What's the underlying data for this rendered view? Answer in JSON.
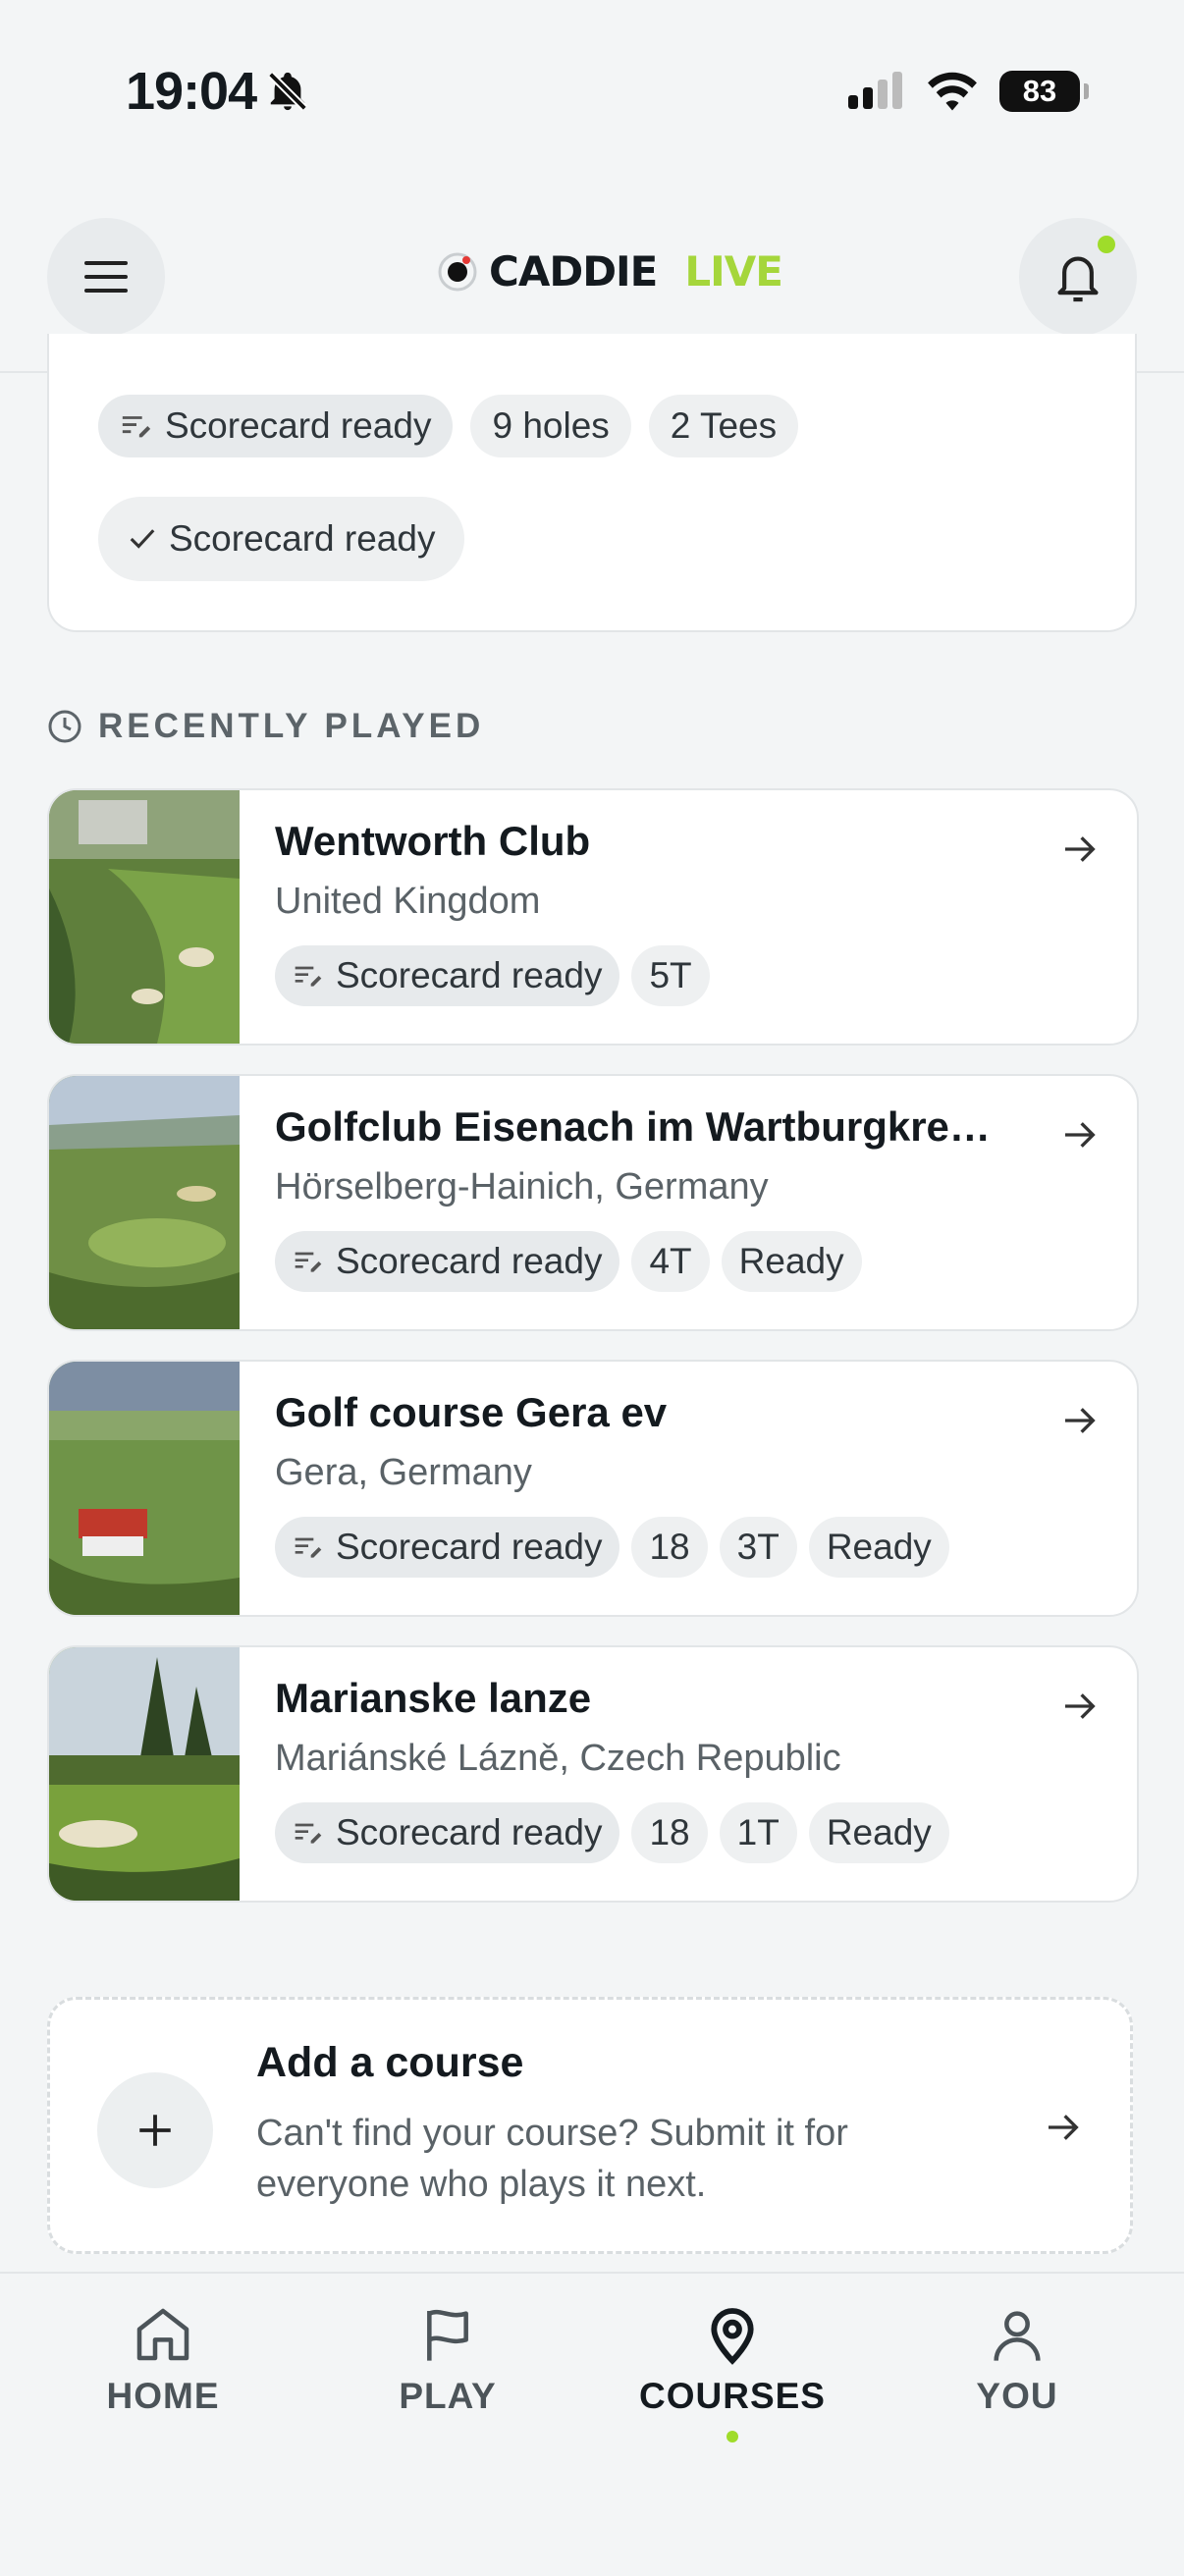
{
  "status_bar": {
    "time": "19:04",
    "battery": "83"
  },
  "header": {
    "brand_main": "CADDIE",
    "brand_accent": "LIVE"
  },
  "top_card": {
    "chips_row1": [
      "Scorecard ready",
      "9 holes",
      "2 Tees"
    ],
    "chip_row2": "Scorecard ready"
  },
  "section": {
    "recently_played": "RECENTLY PLAYED"
  },
  "courses": [
    {
      "name": "Wentworth Club",
      "location": "United Kingdom",
      "chips": [
        "Scorecard ready",
        "5T"
      ]
    },
    {
      "name": "Golfclub Eisenach im Wartburgkre…",
      "location": "Hörselberg-Hainich, Germany",
      "chips": [
        "Scorecard ready",
        "4T",
        "Ready"
      ]
    },
    {
      "name": "Golf course Gera ev",
      "location": "Gera, Germany",
      "chips": [
        "Scorecard ready",
        "18",
        "3T",
        "Ready"
      ]
    },
    {
      "name": "Marianske lanze",
      "location": "Mariánské Lázně, Czech Republic",
      "chips": [
        "Scorecard ready",
        "18",
        "1T",
        "Ready"
      ]
    }
  ],
  "add_course": {
    "title": "Add a course",
    "line1": "Can't find your course? Submit it for",
    "line2": "everyone who plays it next."
  },
  "tabs": [
    {
      "label": "HOME",
      "icon": "home-icon"
    },
    {
      "label": "PLAY",
      "icon": "flag-icon"
    },
    {
      "label": "COURSES",
      "icon": "map-pin-icon",
      "active": true
    },
    {
      "label": "YOU",
      "icon": "user-icon"
    }
  ],
  "colors": {
    "accent": "#a5d63b",
    "background": "#f3f5f6",
    "chip": "#e7eaec"
  }
}
